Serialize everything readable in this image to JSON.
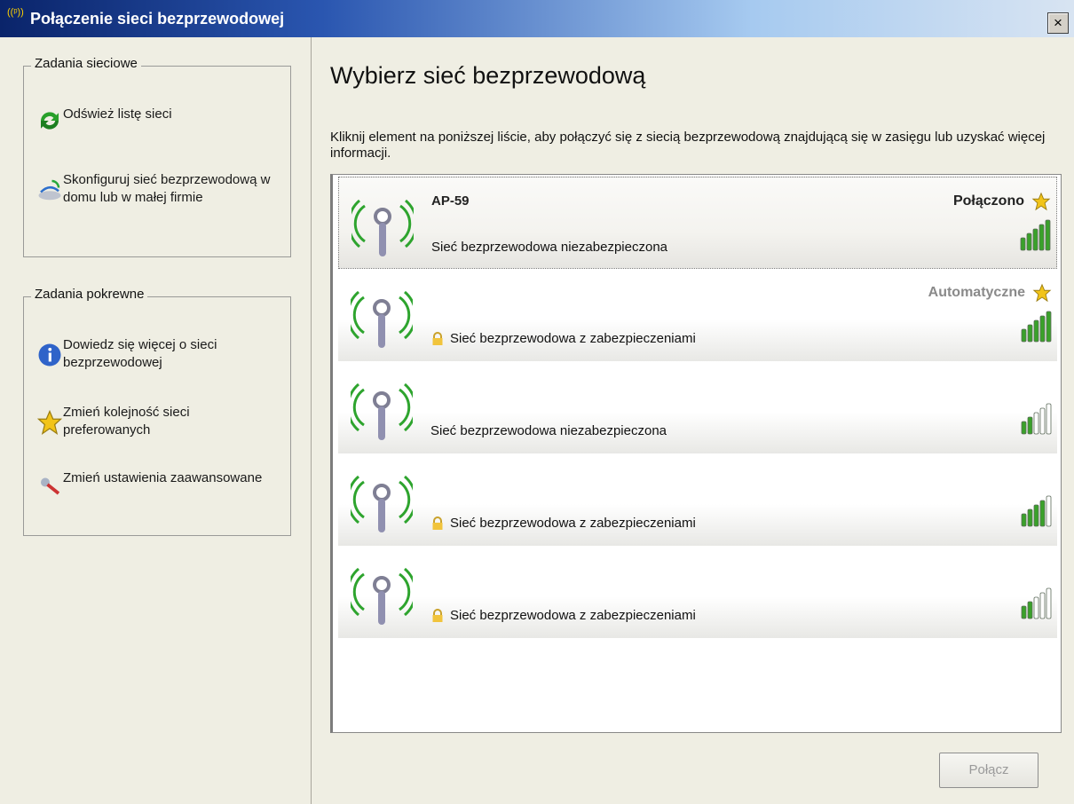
{
  "window": {
    "title": "Połączenie sieci bezprzewodowej",
    "title_icon": "((ᵖ))",
    "close_label": "×"
  },
  "sidebar": {
    "network_tasks": {
      "title": "Zadania sieciowe",
      "items": [
        {
          "label": "Odśwież listę sieci",
          "icon": "refresh-icon"
        },
        {
          "label": "Skonfiguruj sieć bezprzewodową w domu lub w małej firmie",
          "icon": "setup-icon"
        }
      ]
    },
    "related_tasks": {
      "title": "Zadania pokrewne",
      "items": [
        {
          "label": "Dowiedz się więcej o sieci bezprzewodowej",
          "icon": "info-icon"
        },
        {
          "label": "Zmień kolejność sieci preferowanych",
          "icon": "star-icon"
        },
        {
          "label": "Zmień ustawienia zaawansowane",
          "icon": "settings-icon"
        }
      ]
    }
  },
  "main": {
    "heading": "Wybierz sieć bezprzewodową",
    "description": "Kliknij element na poniższej liście, aby połączyć się z siecią bezprzewodową znajdującą się w zasięgu lub uzyskać więcej informacji.",
    "networks": [
      {
        "name": "AP-59",
        "status": "Połączono",
        "security": "Sieć bezprzewodowa niezabezpieczona",
        "secured": false,
        "signal_bars": 5,
        "selected": true
      },
      {
        "name": "",
        "status": "Automatyczne",
        "security": "Sieć bezprzewodowa z zabezpieczeniami",
        "secured": true,
        "signal_bars": 5,
        "selected": false
      },
      {
        "name": "",
        "status": "",
        "security": "Sieć bezprzewodowa niezabezpieczona",
        "secured": false,
        "signal_bars": 2,
        "selected": false
      },
      {
        "name": "",
        "status": "",
        "security": "Sieć bezprzewodowa z zabezpieczeniami",
        "secured": true,
        "signal_bars": 4,
        "selected": false
      },
      {
        "name": "",
        "status": "",
        "security": "Sieć bezprzewodowa z zabezpieczeniami",
        "secured": true,
        "signal_bars": 2,
        "selected": false
      }
    ],
    "connect_button": "Połącz"
  },
  "colors": {
    "signal_green": "#3aa12a",
    "signal_empty": "#ffffff",
    "status_connected": "#222222",
    "status_auto": "#8a8a8a"
  }
}
